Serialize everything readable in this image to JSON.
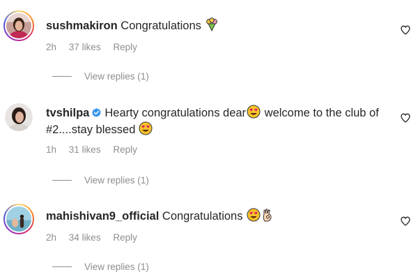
{
  "comments": [
    {
      "username": "sushmakiron",
      "text": "Congratulations",
      "time": "2h",
      "likes": "37 likes",
      "reply_label": "Reply",
      "view_replies": "View replies (1)",
      "verified": false
    },
    {
      "username": "tvshilpa",
      "text_part1": "Hearty congratulations dear",
      "text_part2": " welcome to the club of #2....stay blessed",
      "time": "1h",
      "likes": "31 likes",
      "reply_label": "Reply",
      "view_replies": "View replies (1)",
      "verified": true
    },
    {
      "username": "mahishivan9_official",
      "text": "Congratulations",
      "time": "2h",
      "likes": "34 likes",
      "reply_label": "Reply",
      "view_replies": "View replies (1)",
      "verified": false
    }
  ],
  "icons": {
    "like": "heart-outline-icon",
    "verified": "verified-badge-icon",
    "bouquet": "bouquet-emoji",
    "heart_eyes": "heart-eyes-emoji",
    "ok_hand": "ok-hand-emoji"
  },
  "colors": {
    "text": "#262626",
    "meta": "#8e8e8e",
    "verified": "#3897f0"
  }
}
